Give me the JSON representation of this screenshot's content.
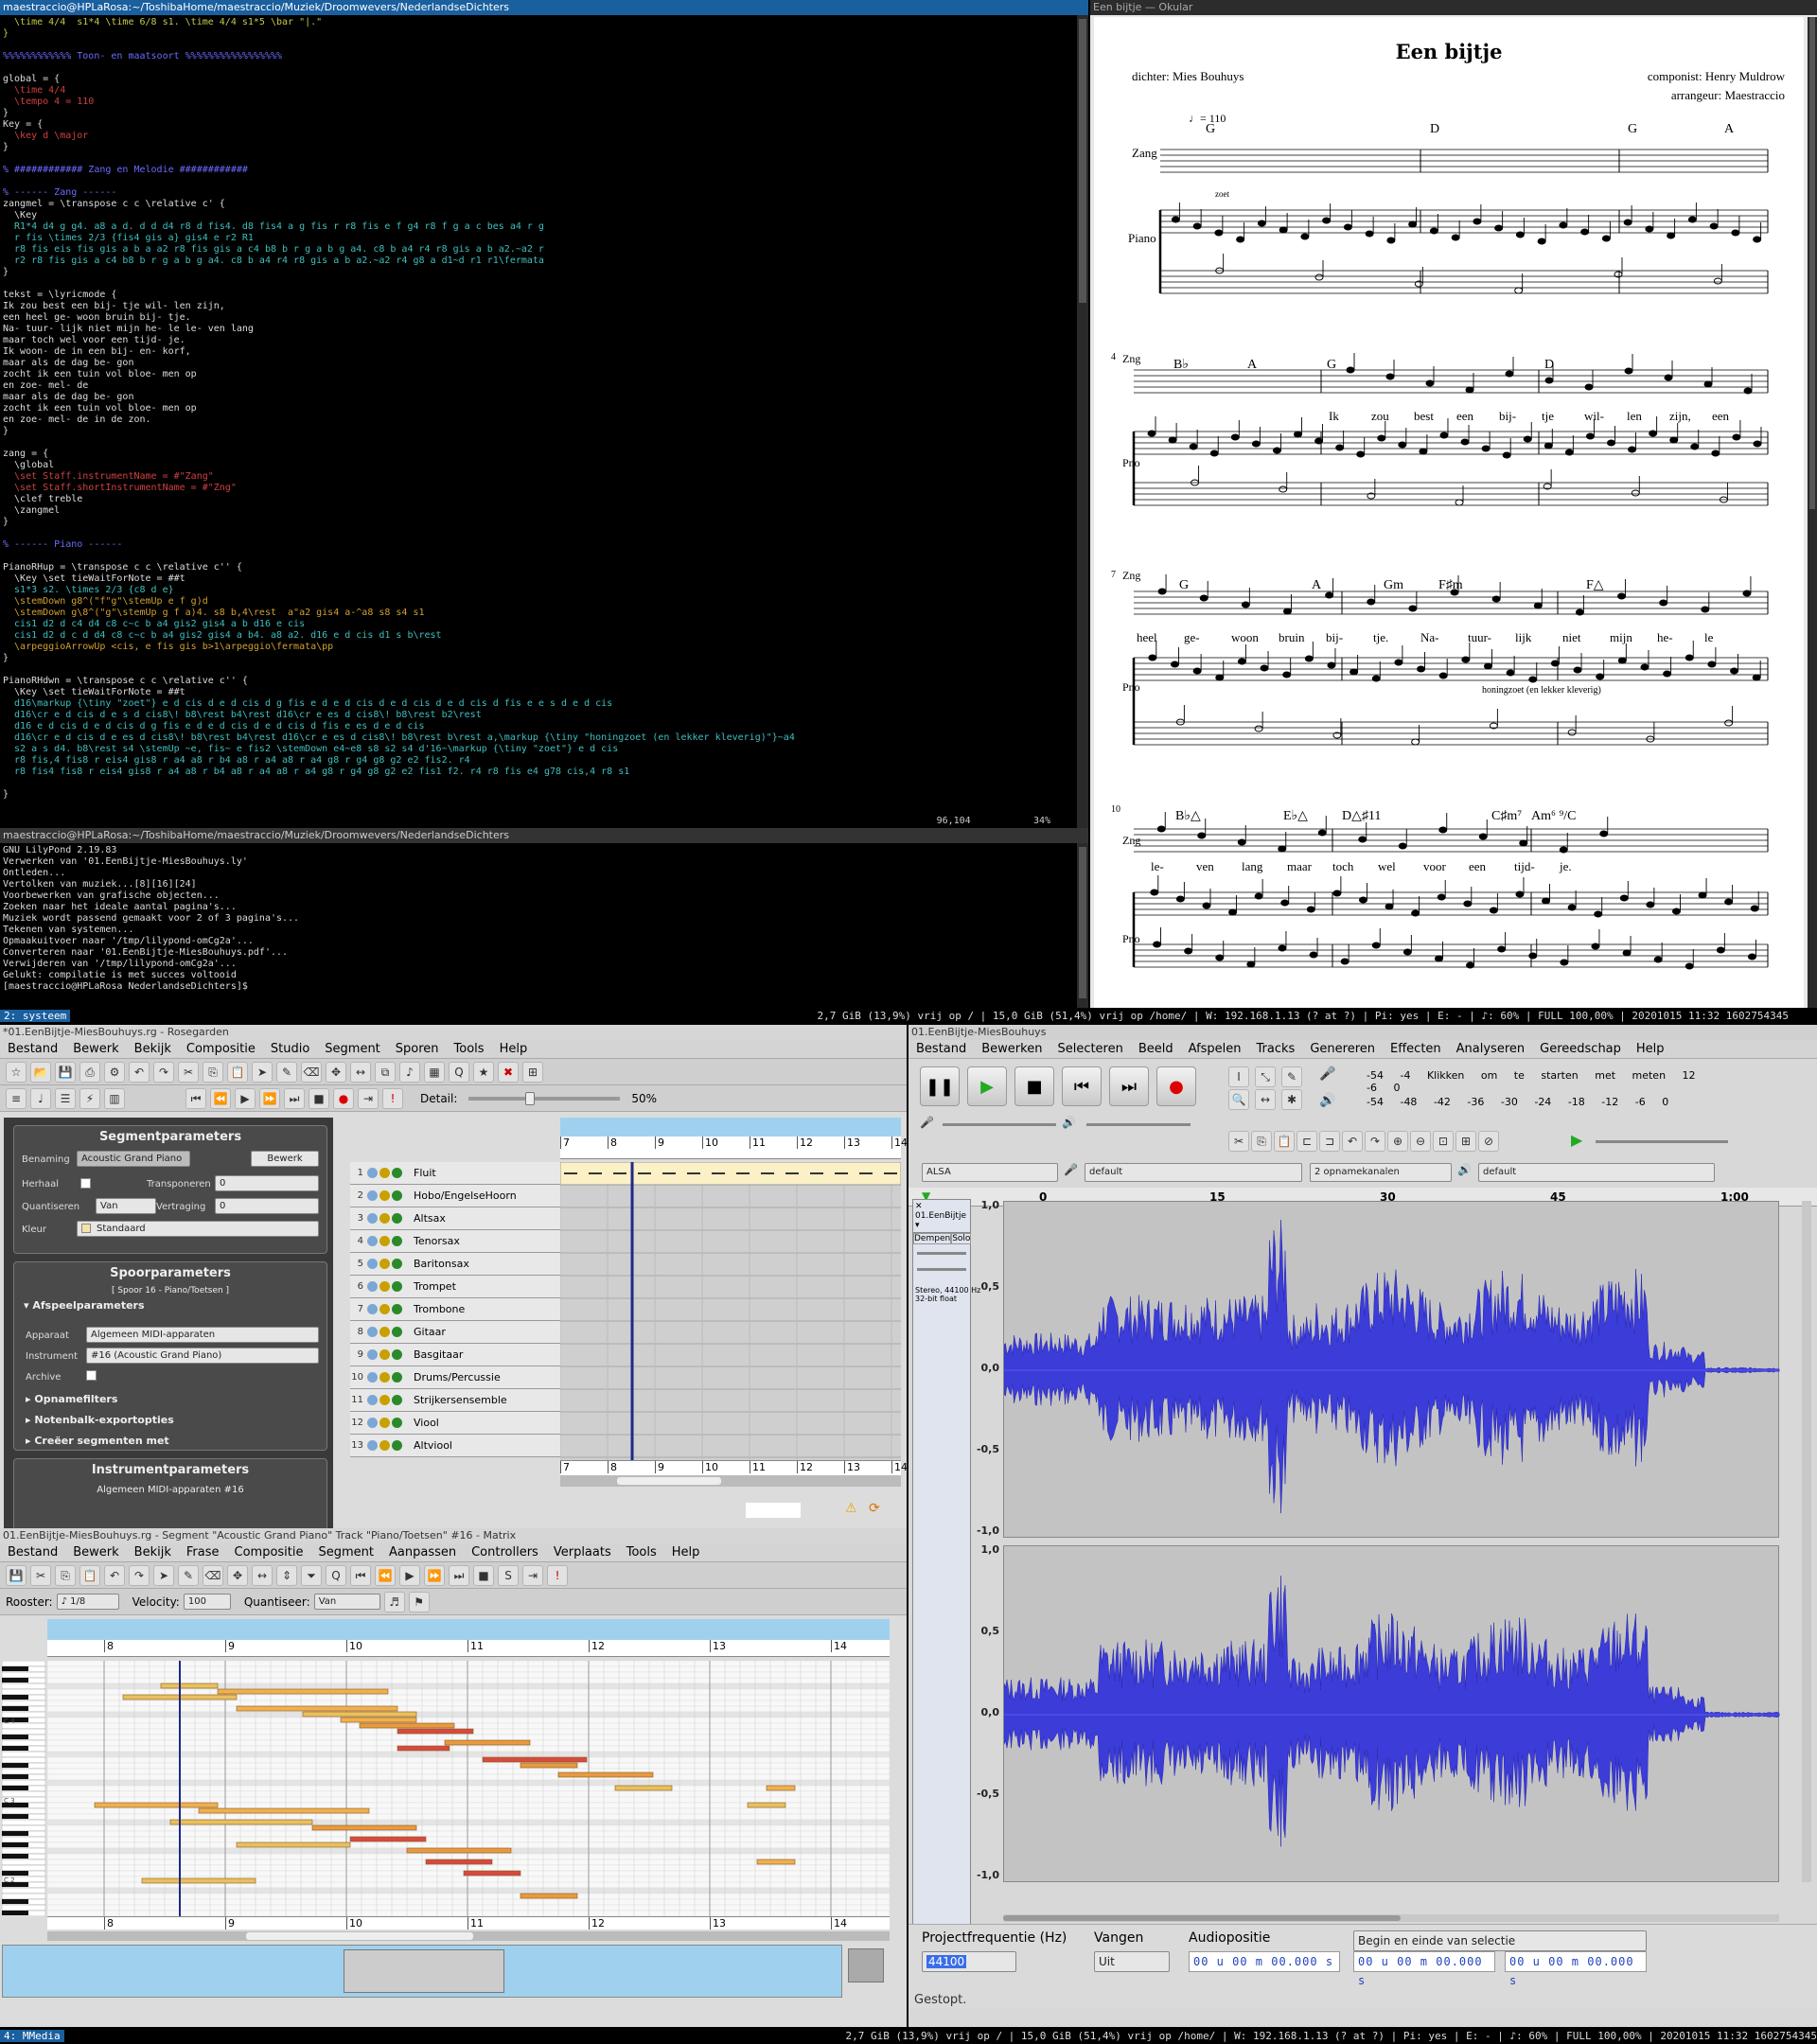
{
  "editor": {
    "title": "maestraccio@HPLaRosa:~/ToshibaHome/maestraccio/Muziek/Droomwevers/NederlandseDichters",
    "lines": [
      [
        "  \\time 4/4  s1*4 \\time 6/8 s1. \\time 4/4 s1*5 \\bar \"|.\"",
        "#c8c850"
      ],
      [
        "}",
        "#c8c850"
      ],
      [
        "",
        "#ccc"
      ],
      [
        "%%%%%%%%%%%% Toon- en maatsoort %%%%%%%%%%%%%%%%%",
        "#6a6aff"
      ],
      [
        "",
        "#ccc"
      ],
      [
        "global = {",
        "#ddd"
      ],
      [
        "  \\time 4/4",
        "#d04040"
      ],
      [
        "  \\tempo 4 = 110",
        "#d04040"
      ],
      [
        "}",
        "#ddd"
      ],
      [
        "Key = {",
        "#ddd"
      ],
      [
        "  \\key d \\major",
        "#d04040"
      ],
      [
        "}",
        "#ddd"
      ],
      [
        "",
        "#ccc"
      ],
      [
        "% ############ Zang en Melodie ############",
        "#6a6aff"
      ],
      [
        "",
        "#ccc"
      ],
      [
        "% ------ Zang ------",
        "#6a6aff"
      ],
      [
        "zangmel = \\transpose c c \\relative c' {",
        "#ddd"
      ],
      [
        "  \\Key",
        "#ddd"
      ],
      [
        "  R1*4 d4 g g4. a8 a d. d d d4 r8 d fis4. d8 fis4 a g fis r r8 fis e f g4 r8 f g a c bes a4 r g",
        "#3fbfbf"
      ],
      [
        "  r fis \\times 2/3 {fis4 gis a} gis4 e r2 R1",
        "#3fbfbf"
      ],
      [
        "  r8 fis eis fis gis a b a a2 r8 fis gis a c4 b8 b r g a b g a4. c8 b a4 r4 r8 gis a b a2.~a2 r",
        "#3fbfbf"
      ],
      [
        "  r2 r8 fis gis a c4 b8 b r g a b g a4. c8 b a4 r4 r8 gis a b a2.~a2 r4 g8 a d1~d r1 r1\\fermata",
        "#3fbfbf"
      ],
      [
        "}",
        "#ddd"
      ],
      [
        "",
        "#ccc"
      ],
      [
        "tekst = \\lyricmode {",
        "#ddd"
      ],
      [
        "Ik zou best een bij- tje wil- len zijn,",
        "#ddd"
      ],
      [
        "een heel ge- woon bruin bij- tje.",
        "#ddd"
      ],
      [
        "Na- tuur- lijk niet mijn he- le le- ven lang",
        "#ddd"
      ],
      [
        "maar toch wel voor een tijd- je.",
        "#ddd"
      ],
      [
        "Ik woon- de in een bij- en- korf,",
        "#ddd"
      ],
      [
        "maar als de dag be- gon",
        "#ddd"
      ],
      [
        "zocht ik een tuin vol bloe- men op",
        "#ddd"
      ],
      [
        "en zoe- mel- de",
        "#ddd"
      ],
      [
        "maar als de dag be- gon",
        "#ddd"
      ],
      [
        "zocht ik een tuin vol bloe- men op",
        "#ddd"
      ],
      [
        "en zoe- mel- de in de zon.",
        "#ddd"
      ],
      [
        "}",
        "#ddd"
      ],
      [
        "",
        "#ccc"
      ],
      [
        "zang = {",
        "#ddd"
      ],
      [
        "  \\global",
        "#ddd"
      ],
      [
        "  \\set Staff.instrumentName = #\"Zang\"",
        "#d04040"
      ],
      [
        "  \\set Staff.shortInstrumentName = #\"Zng\"",
        "#d04040"
      ],
      [
        "  \\clef treble",
        "#ddd"
      ],
      [
        "  \\zangmel",
        "#ddd"
      ],
      [
        "}",
        "#ddd"
      ],
      [
        "",
        "#ccc"
      ],
      [
        "% ------ Piano ------",
        "#6a6aff"
      ],
      [
        "",
        "#ccc"
      ],
      [
        "PianoRHup = \\transpose c c \\relative c'' {",
        "#ddd"
      ],
      [
        "  \\Key \\set tieWaitForNote = ##t",
        "#ddd"
      ],
      [
        "  s1*3 s2. \\times 2/3 {c8 d e}",
        "#3fbfbf"
      ],
      [
        "  \\stemDown g8^(\"f\"g\"\\stemUp e f g)d",
        "#d0a030"
      ],
      [
        "  \\stemDown g\\8^(\"g\"\\stemUp g f a)4. s8 b,4\\rest  a\"a2 gis4 a-^a8 s8 s4 s1",
        "#d0a030"
      ],
      [
        "  cis1 d2 d c4 d4 c8 c~c b a4 gis2 gis4 a b d16 e cis",
        "#3fbfbf"
      ],
      [
        "  cis1 d2 d c d d4 c8 c~c b a4 gis2 gis4 a b4. a8 a2. d16 e d cis d1 s b\\rest",
        "#3fbfbf"
      ],
      [
        "  \\arpeggioArrowUp <cis, e fis gis b>1\\arpeggio\\fermata\\pp",
        "#d0a030"
      ],
      [
        "}",
        "#ddd"
      ],
      [
        "",
        "#ccc"
      ],
      [
        "PianoRHdwn = \\transpose c c \\relative c'' {",
        "#ddd"
      ],
      [
        "  \\Key \\set tieWaitForNote = ##t",
        "#ddd"
      ],
      [
        "  d16\\markup {\\tiny \"zoet\"} e d cis d e d cis d g fis e d e d cis d e d cis d e d cis d fis e e s d e d cis",
        "#3fbfbf"
      ],
      [
        "  d16\\cr e d cis d e s d cis8\\! b8\\rest b4\\rest d16\\cr e es d cis8\\! b8\\rest b2\\rest",
        "#3fbfbf"
      ],
      [
        "  d16 e d cis d e d cis d g fis e d e d cis d e d cis d fis e es d e d cis",
        "#3fbfbf"
      ],
      [
        "  d16\\cr e d cis d e es d cis8\\! b8\\rest b4\\rest d16\\cr e es d cis8\\! b8\\rest b\\rest a,\\markup {\\tiny \"honingzoet (en lekker kleverig)\"}~a4",
        "#3fbfbf"
      ],
      [
        "  s2 a s d4. b8\\rest s4 \\stemUp ~e, fis~ e fis2 \\stemDown e4~e8 s8 s2 s4 d'16~\\markup {\\tiny \"zoet\"} e d cis",
        "#3fbfbf"
      ],
      [
        "  r8 fis,4 fis8 r eis4 gis8 r a4 a8 r b4 a8 r a4 a8 r a4 g8 r g4 g8 g2 e2 fis2. r4",
        "#3fbfbf"
      ],
      [
        "  r8 fis4 fis8 r eis4 gis8 r a4 a8 r b4 a8 r a4 a8 r a4 g8 r g4 g8 g2 e2 fis1 f2. r4 r8 fis e4 g78 cis,4 r8 s1",
        "#3fbfbf"
      ],
      [
        "",
        "#ccc"
      ],
      [
        "}",
        "#ddd"
      ]
    ],
    "position": "96,104",
    "percent": "34%"
  },
  "terminal": {
    "title": "maestraccio@HPLaRosa:~/ToshibaHome/maestraccio/Muziek/Droomwevers/NederlandseDichters",
    "lines": [
      "GNU LilyPond 2.19.83",
      "Verwerken van '01.EenBijtje-MiesBouhuys.ly'",
      "Ontleden...",
      "Vertolken van muziek...[8][16][24]",
      "Voorbewerken van grafische objecten...",
      "Zoeken naar het ideale aantal pagina's...",
      "Muziek wordt passend gemaakt voor 2 of 3 pagina's...",
      "Tekenen van systemen...",
      "Opmaakuitvoer naar '/tmp/lilypond-omCg2a'...",
      "Converteren naar '01.EenBijtje-MiesBouhuys.pdf'...",
      "Verwijderen van '/tmp/lilypond-omCg2a'...",
      "Gelukt: compilatie is met succes voltooid",
      "[maestraccio@HPLaRosa NederlandseDichters]$ "
    ]
  },
  "okular": {
    "title": "Een bijtje — Okular",
    "score": {
      "title": "Een bijtje",
      "poet": "dichter: Mies Bouhuys",
      "composer": "componist: Henry Muldrow",
      "arranger": "arrangeur: Maestraccio",
      "tempo": "♩= 110",
      "staff_zang": "Zang",
      "staff_piano": "Piano",
      "staff_zng": "Zng",
      "staff_pno": "Pno",
      "dyn_zoet": "zoet",
      "dyn_honing": "honingzoet (en lekker kleverig)",
      "measure_numbers": [
        "4",
        "7",
        "10"
      ],
      "chords_sys1": [
        "G",
        "D",
        "G",
        "A"
      ],
      "chords_sys2": [
        "B♭",
        "A",
        "G",
        "D"
      ],
      "chords_sys3": [
        "G",
        "A",
        "Gm",
        "F♯m",
        "F△"
      ],
      "chords_sys4": [
        "B♭△",
        "E♭△",
        "D△♯11",
        "C♯m⁷",
        "Am⁶ ⁹/C"
      ],
      "lyrics_sys2": [
        "Ik",
        "zou",
        "best",
        "een",
        "bij-",
        "tje",
        "wil-",
        "len",
        "zijn,",
        "een"
      ],
      "lyrics_sys3": [
        "heel",
        "ge-",
        "woon",
        "bruin",
        "bij-",
        "tje.",
        "Na-",
        "tuur-",
        "lijk",
        "niet",
        "mijn",
        "he-",
        "le"
      ],
      "lyrics_sys4": [
        "le-",
        "ven",
        "lang",
        "maar",
        "toch",
        "wel",
        "voor",
        "een",
        "tijd-",
        "je."
      ]
    }
  },
  "panel1": {
    "workspace": "2: systeem",
    "info": "2,7 GiB (13,9%) vrij op / | 15,0 GiB (51,4%) vrij op /home/ | W: 192.168.1.13 (? at ?) | Pi: yes | E: - | ♪: 60% | FULL 100,00% | 20201015 11:32 1602754345"
  },
  "panel2": {
    "workspace": "4: MMedia",
    "info": "2,7 GiB (13,9%) vrij op / | 15,0 GiB (51,4%) vrij op /home/ | W: 192.168.1.13 (? at ?) | Pi: yes | E: - | ♪: 60% | FULL 100,00% | 20201015 11:32 1602754345"
  },
  "rosegarden": {
    "title": "*01.EenBijtje-MiesBouhuys.rg - Rosegarden",
    "menu": [
      "Bestand",
      "Bewerk",
      "Bekijk",
      "Compositie",
      "Studio",
      "Segment",
      "Sporen",
      "Tools",
      "Help"
    ],
    "detail_label": "Detail:",
    "detail_value": "50%",
    "segment_params": {
      "title": "Segmentparameters",
      "benaming_label": "Benaming",
      "benaming_value": "Acoustic Grand Piano",
      "bewerk": "Bewerk",
      "herhaal": "Herhaal",
      "transponeren": "Transponeren",
      "transponeren_value": "0",
      "quantiseren": "Quantiseren",
      "quantiseren_value": "Van",
      "vertraging": "Vertraging",
      "vertraging_value": "0",
      "kleur": "Kleur",
      "kleur_value": "Standaard"
    },
    "track_params": {
      "title": "Spoorparameters",
      "spoor": "[ Spoor 16 - Piano/Toetsen ]",
      "afspeel": "Afspeelparameters",
      "apparaat": "Apparaat",
      "apparaat_value": "Algemeen MIDI-apparaten",
      "instrument": "Instrument",
      "instrument_value": "#16 (Acoustic Grand Piano)",
      "archive": "Archive",
      "opname": "Opnamefilters",
      "notenbalk": "Notenbalk-exportopties",
      "creeer": "Creëer segmenten met"
    },
    "instr_params": {
      "title": "Instrumentparameters",
      "value": "Algemeen MIDI-apparaten  #16"
    },
    "bar_numbers": [
      "7",
      "8",
      "9",
      "10",
      "11",
      "12",
      "13",
      "14"
    ],
    "tracks": [
      "Fluit",
      "Hobo/EngelseHoorn",
      "Altsax",
      "Tenorsax",
      "Baritonsax",
      "Trompet",
      "Trombone",
      "Gitaar",
      "Basgitaar",
      "Drums/Percussie",
      "Strijkersensemble",
      "Viool",
      "Altviool"
    ]
  },
  "matrix": {
    "title": "01.EenBijtje-MiesBouhuys.rg - Segment \"Acoustic Grand Piano\" Track \"Piano/Toetsen\" #16 - Matrix",
    "menu": [
      "Bestand",
      "Bewerk",
      "Bekijk",
      "Frase",
      "Compositie",
      "Segment",
      "Aanpassen",
      "Controllers",
      "Verplaats",
      "Tools",
      "Help"
    ],
    "rooster_label": "Rooster:",
    "rooster_value": "♪ 1/8",
    "velocity_label": "Velocity:",
    "velocity_value": "100",
    "quantiseer_label": "Quantiseer:",
    "quantiseer_value": "Van",
    "bar_numbers": [
      "8",
      "9",
      "10",
      "11",
      "12",
      "13",
      "14"
    ],
    "key_labels": [
      "C 4",
      "C 3",
      "C 2"
    ]
  },
  "audacity": {
    "title": "01.EenBijtje-MiesBouhuys",
    "menu": [
      "Bestand",
      "Bewerken",
      "Selecteren",
      "Beeld",
      "Afspelen",
      "Tracks",
      "Genereren",
      "Effecten",
      "Analyseren",
      "Gereedschap",
      "Help"
    ],
    "meter_rec": [
      "-54",
      "-4",
      "Klikken om te starten met meten",
      "12",
      "-6",
      "0"
    ],
    "meter_play": [
      "-54",
      "-48",
      "-42",
      "-36",
      "-30",
      "-24",
      "-18",
      "-12",
      "-6",
      "0"
    ],
    "host": "ALSA",
    "rec_device": "default",
    "channels": "2 opnamekanalen",
    "play_device": "default",
    "timeline": [
      "0",
      "15",
      "30",
      "45",
      "1:00"
    ],
    "track_name": "01.EenBijtje",
    "dempen": "Dempen",
    "solo": "Solo",
    "track_info": "Stereo, 44100 Hz\n32-bit float",
    "db_upper": [
      "1,0",
      "0,5",
      "0,0",
      "-0,5",
      "-1,0"
    ],
    "db_lower": [
      "1,0",
      "0,5",
      "0,0",
      "-0,5",
      "-1,0"
    ],
    "project_rate_label": "Projectfrequentie (Hz)",
    "project_rate": "44100",
    "snap_label": "Vangen",
    "snap_value": "Uit",
    "audio_pos_label": "Audiopositie",
    "audio_pos": "00 u 00 m 00.000 s",
    "sel_mode": "Begin en einde van selectie",
    "sel_start": "00 u 00 m 00.000 s",
    "sel_end": "00 u 00 m 00.000 s",
    "status": "Gestopt."
  }
}
